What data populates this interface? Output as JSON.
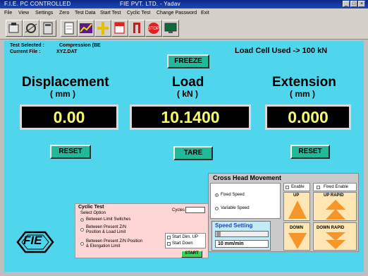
{
  "window": {
    "title": "FIE PVT. LTD. - Yadav",
    "app_name": "F.I.E. PC CONTROLLED"
  },
  "menu": [
    "File",
    "View",
    "Settings",
    "Zero",
    "Test Data",
    "Start Test",
    "Cyclic Test",
    "Change Password",
    "Exit"
  ],
  "toolbar_icons": [
    "open-icon",
    "settings-icon",
    "calculator-icon",
    "report-icon",
    "graph-icon",
    "crosshead-icon",
    "print-icon",
    "clamp-icon",
    "stop-icon",
    "monitor-icon"
  ],
  "header": {
    "test_selected_label": "Test Selected :",
    "test_selected_value": "Compression (BE",
    "current_file_label": "Current File :",
    "current_file_value": "XYZ.DAT",
    "freeze_label": "FREEZE",
    "load_cell_text": "Load Cell Used -> 100 kN"
  },
  "readouts": {
    "displacement": {
      "title": "Displacement",
      "unit": "( mm )",
      "value": "0.00",
      "button": "RESET"
    },
    "load": {
      "title": "Load",
      "unit": "( kN )",
      "value": "10.1400",
      "button": "TARE"
    },
    "extension": {
      "title": "Extension",
      "unit": "( mm )",
      "value": "0.000",
      "button": "RESET"
    }
  },
  "cyclic_test": {
    "title": "Cyclic Test",
    "select_option": "Select Option",
    "cycles_label": "Cycles",
    "options": [
      "Between Limit Switches",
      "Between Present Z/N Position & Load Limit",
      "Between Present Z/N Position & Elongation Limit"
    ],
    "start_dirn_up": "Start Dirn. UP",
    "start_down": "Start Down",
    "start_button": "START"
  },
  "crosshead": {
    "title": "Cross Head Movement",
    "fixed_speed": "Fixed Speed",
    "variable_speed": "Variable Speed",
    "speed_setting_title": "Speed Setting",
    "speed_value": "10  mm/min",
    "enable_label": "Enable",
    "fixed_enable_label": "Fixed Enable",
    "up_label": "UP",
    "up_rapid_label": "UP RAPID",
    "down_label": "DOWN",
    "down_rapid_label": "DOWN RAPID"
  },
  "logo": {
    "text": "FIE"
  },
  "colors": {
    "panel_bg": "#4fd6ec",
    "display_text": "#fafa6e",
    "button_green": "#22b89a",
    "arrow_orange": "#f5962a",
    "cyclic_bg": "#ffd6d6"
  }
}
